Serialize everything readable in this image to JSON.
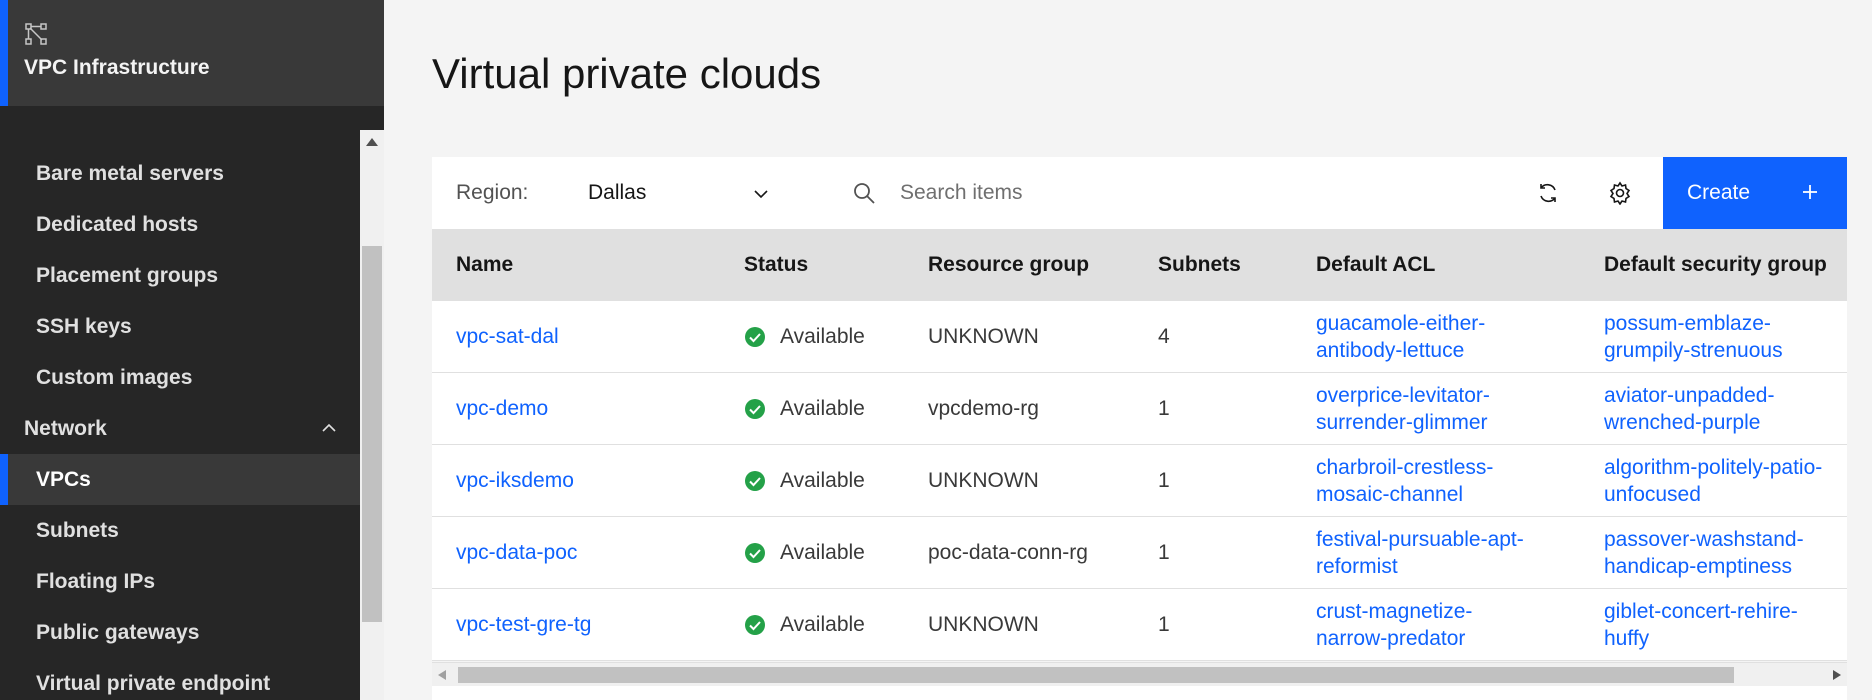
{
  "app": {
    "title": "VPC Infrastructure",
    "icon": "vpc-network-icon"
  },
  "sidebar": {
    "items": [
      {
        "label": "Bare metal servers",
        "type": "item"
      },
      {
        "label": "Dedicated hosts",
        "type": "item"
      },
      {
        "label": "Placement groups",
        "type": "item"
      },
      {
        "label": "SSH keys",
        "type": "item"
      },
      {
        "label": "Custom images",
        "type": "item"
      },
      {
        "label": "Network",
        "type": "section",
        "expanded": true
      },
      {
        "label": "VPCs",
        "type": "item",
        "active": true
      },
      {
        "label": "Subnets",
        "type": "item"
      },
      {
        "label": "Floating IPs",
        "type": "item"
      },
      {
        "label": "Public gateways",
        "type": "item"
      },
      {
        "label": "Virtual private endpoint",
        "type": "item"
      }
    ]
  },
  "page": {
    "title": "Virtual private clouds"
  },
  "toolbar": {
    "region_label": "Region:",
    "region_value": "Dallas",
    "search_placeholder": "Search items",
    "create_label": "Create"
  },
  "table": {
    "columns": [
      "Name",
      "Status",
      "Resource group",
      "Subnets",
      "Default ACL",
      "Default security group"
    ],
    "rows": [
      {
        "name": "vpc-sat-dal",
        "status": "Available",
        "resource_group": "UNKNOWN",
        "subnets": "4",
        "acl_1": "guacamole-either-",
        "acl_2": "antibody-lettuce",
        "sg_1": "possum-emblaze-",
        "sg_2": "grumpily-strenuous"
      },
      {
        "name": "vpc-demo",
        "status": "Available",
        "resource_group": "vpcdemo-rg",
        "subnets": "1",
        "acl_1": "overprice-levitator-",
        "acl_2": "surrender-glimmer",
        "sg_1": "aviator-unpadded-",
        "sg_2": "wrenched-purple"
      },
      {
        "name": "vpc-iksdemo",
        "status": "Available",
        "resource_group": "UNKNOWN",
        "subnets": "1",
        "acl_1": "charbroil-crestless-",
        "acl_2": "mosaic-channel",
        "sg_1": "algorithm-politely-patio-",
        "sg_2": "unfocused"
      },
      {
        "name": "vpc-data-poc",
        "status": "Available",
        "resource_group": "poc-data-conn-rg",
        "subnets": "1",
        "acl_1": "festival-pursuable-apt-",
        "acl_2": "reformist",
        "sg_1": "passover-washstand-",
        "sg_2": "handicap-emptiness"
      },
      {
        "name": "vpc-test-gre-tg",
        "status": "Available",
        "resource_group": "UNKNOWN",
        "subnets": "1",
        "acl_1": "crust-magnetize-",
        "acl_2": "narrow-predator",
        "sg_1": "giblet-concert-rehire-",
        "sg_2": "huffy"
      }
    ]
  },
  "colors": {
    "accent": "#0f62fe",
    "success": "#24a148",
    "sidebar_bg": "#262626"
  }
}
